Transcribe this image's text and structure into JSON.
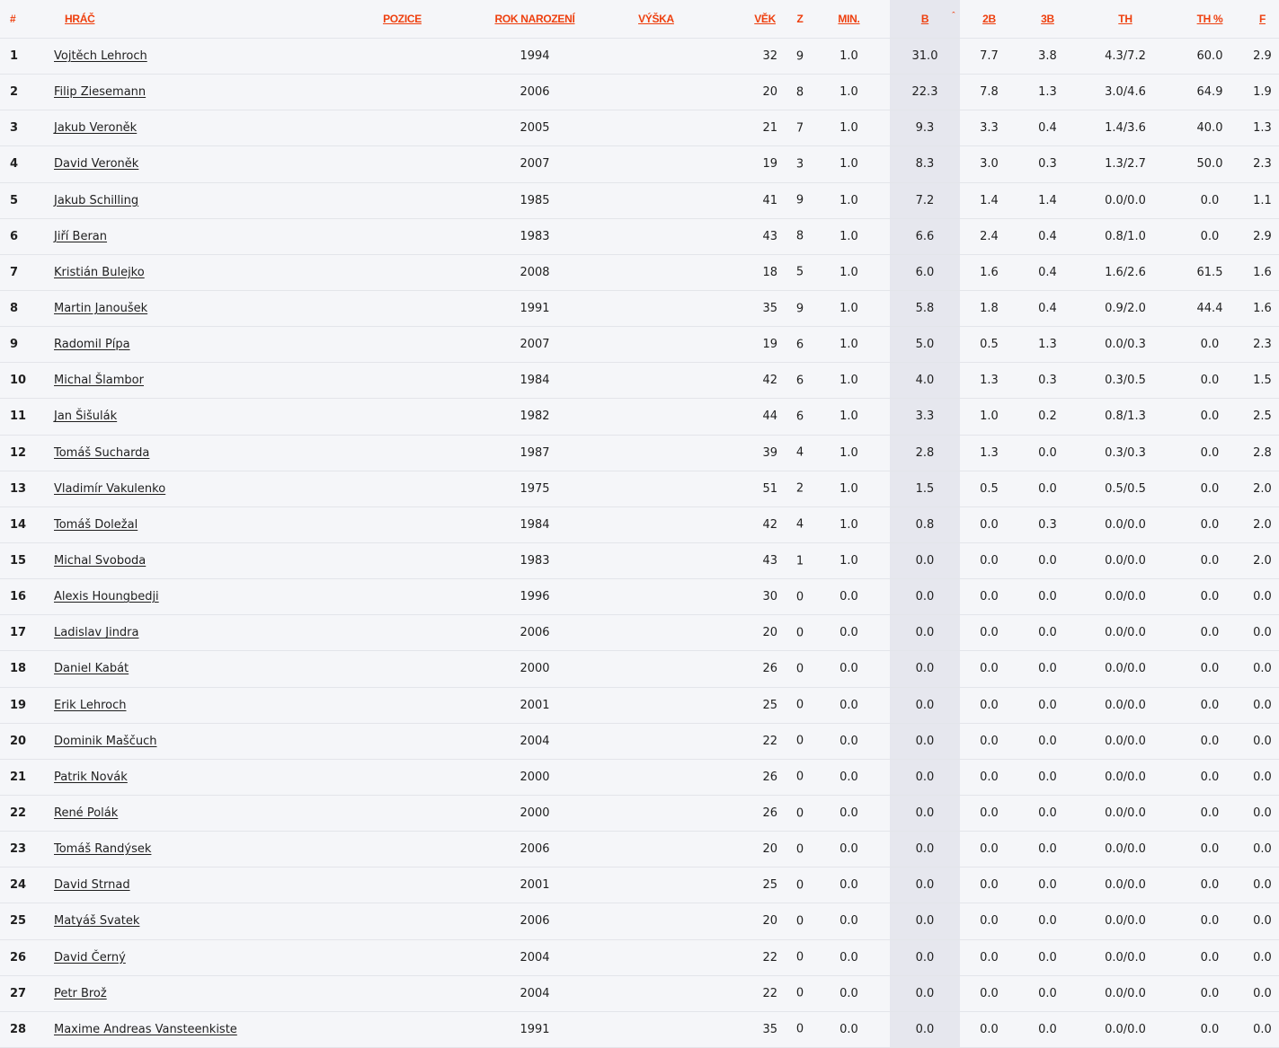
{
  "table": {
    "headers": {
      "rank": "#",
      "player": "HRÁČ",
      "position": "POZICE",
      "birth_year": "ROK NAROZENÍ",
      "height": "VÝŠKA",
      "age": "VĚK",
      "games": "Z",
      "minutes": "MIN.",
      "points": "B",
      "two_pt": "2B",
      "three_pt": "3B",
      "free_throws": "TH",
      "free_throw_pct": "TH %",
      "fouls": "F"
    },
    "sort_indicator": "ˆ",
    "sorted_column": "points",
    "accent_color": "#ee3f0e",
    "rows": [
      {
        "rank": "1",
        "name": "Vojtěch Lehroch",
        "year": "1994",
        "age": "32",
        "games": "9",
        "min": "1.0",
        "pts": "31.0",
        "two": "7.7",
        "three": "3.8",
        "ft": "4.3/7.2",
        "ftpct": "60.0",
        "fouls": "2.9"
      },
      {
        "rank": "2",
        "name": "Filip Ziesemann",
        "year": "2006",
        "age": "20",
        "games": "8",
        "min": "1.0",
        "pts": "22.3",
        "two": "7.8",
        "three": "1.3",
        "ft": "3.0/4.6",
        "ftpct": "64.9",
        "fouls": "1.9"
      },
      {
        "rank": "3",
        "name": "Jakub Veroněk",
        "year": "2005",
        "age": "21",
        "games": "7",
        "min": "1.0",
        "pts": "9.3",
        "two": "3.3",
        "three": "0.4",
        "ft": "1.4/3.6",
        "ftpct": "40.0",
        "fouls": "1.3"
      },
      {
        "rank": "4",
        "name": "David Veroněk",
        "year": "2007",
        "age": "19",
        "games": "3",
        "min": "1.0",
        "pts": "8.3",
        "two": "3.0",
        "three": "0.3",
        "ft": "1.3/2.7",
        "ftpct": "50.0",
        "fouls": "2.3"
      },
      {
        "rank": "5",
        "name": "Jakub Schilling",
        "year": "1985",
        "age": "41",
        "games": "9",
        "min": "1.0",
        "pts": "7.2",
        "two": "1.4",
        "three": "1.4",
        "ft": "0.0/0.0",
        "ftpct": "0.0",
        "fouls": "1.1"
      },
      {
        "rank": "6",
        "name": "Jiří Beran",
        "year": "1983",
        "age": "43",
        "games": "8",
        "min": "1.0",
        "pts": "6.6",
        "two": "2.4",
        "three": "0.4",
        "ft": "0.8/1.0",
        "ftpct": "0.0",
        "fouls": "2.9"
      },
      {
        "rank": "7",
        "name": "Kristián Bulejko",
        "year": "2008",
        "age": "18",
        "games": "5",
        "min": "1.0",
        "pts": "6.0",
        "two": "1.6",
        "three": "0.4",
        "ft": "1.6/2.6",
        "ftpct": "61.5",
        "fouls": "1.6"
      },
      {
        "rank": "8",
        "name": "Martin Janoušek",
        "year": "1991",
        "age": "35",
        "games": "9",
        "min": "1.0",
        "pts": "5.8",
        "two": "1.8",
        "three": "0.4",
        "ft": "0.9/2.0",
        "ftpct": "44.4",
        "fouls": "1.6"
      },
      {
        "rank": "9",
        "name": "Radomil Pípa",
        "year": "2007",
        "age": "19",
        "games": "6",
        "min": "1.0",
        "pts": "5.0",
        "two": "0.5",
        "three": "1.3",
        "ft": "0.0/0.3",
        "ftpct": "0.0",
        "fouls": "2.3"
      },
      {
        "rank": "10",
        "name": "Michal Šlambor",
        "year": "1984",
        "age": "42",
        "games": "6",
        "min": "1.0",
        "pts": "4.0",
        "two": "1.3",
        "three": "0.3",
        "ft": "0.3/0.5",
        "ftpct": "0.0",
        "fouls": "1.5"
      },
      {
        "rank": "11",
        "name": "Jan Šišulák",
        "year": "1982",
        "age": "44",
        "games": "6",
        "min": "1.0",
        "pts": "3.3",
        "two": "1.0",
        "three": "0.2",
        "ft": "0.8/1.3",
        "ftpct": "0.0",
        "fouls": "2.5"
      },
      {
        "rank": "12",
        "name": "Tomáš Sucharda",
        "year": "1987",
        "age": "39",
        "games": "4",
        "min": "1.0",
        "pts": "2.8",
        "two": "1.3",
        "three": "0.0",
        "ft": "0.3/0.3",
        "ftpct": "0.0",
        "fouls": "2.8"
      },
      {
        "rank": "13",
        "name": "Vladimír Vakulenko",
        "year": "1975",
        "age": "51",
        "games": "2",
        "min": "1.0",
        "pts": "1.5",
        "two": "0.5",
        "three": "0.0",
        "ft": "0.5/0.5",
        "ftpct": "0.0",
        "fouls": "2.0"
      },
      {
        "rank": "14",
        "name": "Tomáš Doležal",
        "year": "1984",
        "age": "42",
        "games": "4",
        "min": "1.0",
        "pts": "0.8",
        "two": "0.0",
        "three": "0.3",
        "ft": "0.0/0.0",
        "ftpct": "0.0",
        "fouls": "2.0"
      },
      {
        "rank": "15",
        "name": "Michal Svoboda",
        "year": "1983",
        "age": "43",
        "games": "1",
        "min": "1.0",
        "pts": "0.0",
        "two": "0.0",
        "three": "0.0",
        "ft": "0.0/0.0",
        "ftpct": "0.0",
        "fouls": "2.0"
      },
      {
        "rank": "16",
        "name": "Alexis Houngbedji",
        "year": "1996",
        "age": "30",
        "games": "0",
        "min": "0.0",
        "pts": "0.0",
        "two": "0.0",
        "three": "0.0",
        "ft": "0.0/0.0",
        "ftpct": "0.0",
        "fouls": "0.0"
      },
      {
        "rank": "17",
        "name": "Ladislav Jindra",
        "year": "2006",
        "age": "20",
        "games": "0",
        "min": "0.0",
        "pts": "0.0",
        "two": "0.0",
        "three": "0.0",
        "ft": "0.0/0.0",
        "ftpct": "0.0",
        "fouls": "0.0"
      },
      {
        "rank": "18",
        "name": "Daniel Kabát",
        "year": "2000",
        "age": "26",
        "games": "0",
        "min": "0.0",
        "pts": "0.0",
        "two": "0.0",
        "three": "0.0",
        "ft": "0.0/0.0",
        "ftpct": "0.0",
        "fouls": "0.0"
      },
      {
        "rank": "19",
        "name": "Erik Lehroch",
        "year": "2001",
        "age": "25",
        "games": "0",
        "min": "0.0",
        "pts": "0.0",
        "two": "0.0",
        "three": "0.0",
        "ft": "0.0/0.0",
        "ftpct": "0.0",
        "fouls": "0.0"
      },
      {
        "rank": "20",
        "name": "Dominik Maščuch",
        "year": "2004",
        "age": "22",
        "games": "0",
        "min": "0.0",
        "pts": "0.0",
        "two": "0.0",
        "three": "0.0",
        "ft": "0.0/0.0",
        "ftpct": "0.0",
        "fouls": "0.0"
      },
      {
        "rank": "21",
        "name": "Patrik Novák",
        "year": "2000",
        "age": "26",
        "games": "0",
        "min": "0.0",
        "pts": "0.0",
        "two": "0.0",
        "three": "0.0",
        "ft": "0.0/0.0",
        "ftpct": "0.0",
        "fouls": "0.0"
      },
      {
        "rank": "22",
        "name": "René Polák",
        "year": "2000",
        "age": "26",
        "games": "0",
        "min": "0.0",
        "pts": "0.0",
        "two": "0.0",
        "three": "0.0",
        "ft": "0.0/0.0",
        "ftpct": "0.0",
        "fouls": "0.0"
      },
      {
        "rank": "23",
        "name": "Tomáš Randýsek",
        "year": "2006",
        "age": "20",
        "games": "0",
        "min": "0.0",
        "pts": "0.0",
        "two": "0.0",
        "three": "0.0",
        "ft": "0.0/0.0",
        "ftpct": "0.0",
        "fouls": "0.0"
      },
      {
        "rank": "24",
        "name": "David Strnad",
        "year": "2001",
        "age": "25",
        "games": "0",
        "min": "0.0",
        "pts": "0.0",
        "two": "0.0",
        "three": "0.0",
        "ft": "0.0/0.0",
        "ftpct": "0.0",
        "fouls": "0.0"
      },
      {
        "rank": "25",
        "name": "Matyáš Svatek",
        "year": "2006",
        "age": "20",
        "games": "0",
        "min": "0.0",
        "pts": "0.0",
        "two": "0.0",
        "three": "0.0",
        "ft": "0.0/0.0",
        "ftpct": "0.0",
        "fouls": "0.0"
      },
      {
        "rank": "26",
        "name": "David Černý",
        "year": "2004",
        "age": "22",
        "games": "0",
        "min": "0.0",
        "pts": "0.0",
        "two": "0.0",
        "three": "0.0",
        "ft": "0.0/0.0",
        "ftpct": "0.0",
        "fouls": "0.0"
      },
      {
        "rank": "27",
        "name": "Petr Brož",
        "year": "2004",
        "age": "22",
        "games": "0",
        "min": "0.0",
        "pts": "0.0",
        "two": "0.0",
        "three": "0.0",
        "ft": "0.0/0.0",
        "ftpct": "0.0",
        "fouls": "0.0"
      },
      {
        "rank": "28",
        "name": "Maxime Andreas Vansteenkiste",
        "year": "1991",
        "age": "35",
        "games": "0",
        "min": "0.0",
        "pts": "0.0",
        "two": "0.0",
        "three": "0.0",
        "ft": "0.0/0.0",
        "ftpct": "0.0",
        "fouls": "0.0"
      }
    ]
  }
}
